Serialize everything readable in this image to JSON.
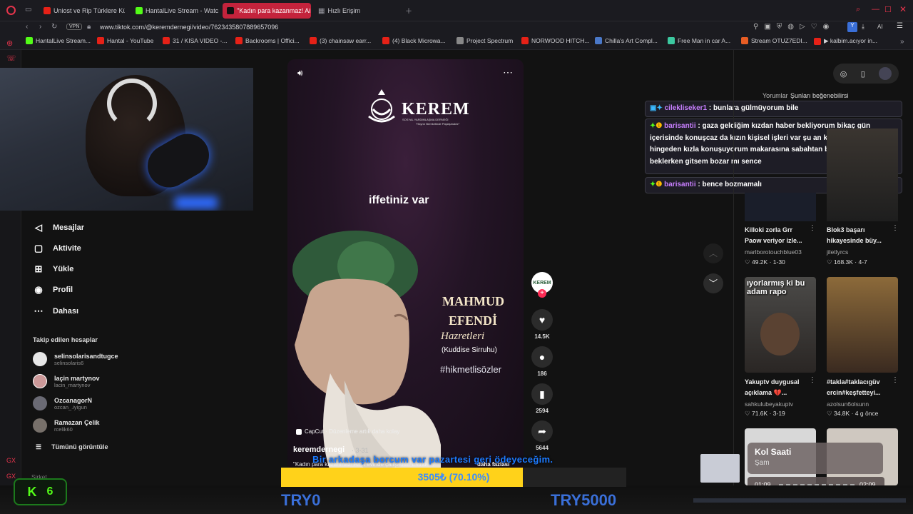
{
  "tabs": [
    {
      "label": "Uniost ve Rip Türklere Kü"
    },
    {
      "label": "HantalLive Stream - Watc"
    },
    {
      "label": "\"Kadın para kazanmaz! Ai"
    },
    {
      "label": "Hızlı Erişim"
    }
  ],
  "address": {
    "url": "www.tiktok.com/@keremdernegi/video/7623435807889657096",
    "vpn": "VPN"
  },
  "bookmarks": [
    "HantalLive Stream...",
    "Hantal - YouTube",
    "31 / KISA VIDEO -...",
    "Backrooms | Offici...",
    "(3) chainsaw earr...",
    "(4) Black Microwa...",
    "Project Spectrum",
    "NORWOOD HITCH...",
    "Chilla's Art Compl...",
    "Free Man in car A...",
    "Stream OTUZ7EDI...",
    "▶ kalbim.acıyor in..."
  ],
  "sidebar": {
    "nav": [
      "Mesajlar",
      "Aktivite",
      "Yükle",
      "Profil",
      "Dahası"
    ],
    "following_title": "Takip edilen hesaplar",
    "accounts": [
      {
        "name": "selinsolarisandtugce",
        "handle": "selinsolaris6"
      },
      {
        "name": "laçin martynov",
        "handle": "lacin_martynov"
      },
      {
        "name": "OzcanagorN",
        "handle": "ozcan_.iyigun"
      },
      {
        "name": "Ramazan Çelik",
        "handle": "rcelik60"
      }
    ],
    "see_all": "Tümünü görüntüle",
    "bottom_cut": "Şirket"
  },
  "video": {
    "logo_name": "KEREM",
    "logo_sub": "SOSYAL YARDIMLAŞMA DERNEĞİ",
    "logo_tag": "\"Hayrın Bereketinde Paylaşmaktır\"",
    "caption_top": "iffetiniz var",
    "name1": "MAHMUD",
    "name2": "EFENDİ",
    "script": "Hazretleri",
    "kuddise": "(Kuddise Sirruhu)",
    "hashtag": "#hikmetlisözler",
    "capcut": "CapCut · Düzenleme artık daha kolay",
    "author": "keremdernegi",
    "date": "3-31",
    "desc": "\"Kadın para kazanmaz! Ama evinde çalışabilir. Evinde...",
    "more": "daha fazlası"
  },
  "actions": [
    {
      "icon": "heart-icon",
      "count": "14.5K"
    },
    {
      "icon": "comment-icon",
      "count": "186"
    },
    {
      "icon": "bookmark-icon",
      "count": "2594"
    },
    {
      "icon": "share-icon",
      "count": "5644"
    }
  ],
  "overlay_subtitle": "Bir arkadaşa borcum var pazartesi geri ödeyeceğim.",
  "chat": [
    {
      "user": "cilekliseker1",
      "msg": "bunlara gülmüyorum bile"
    },
    {
      "user": "barisantii",
      "msg": "gaza geldiğim kızdan haber bekliyorum bikaç gün içerisinde konuşcaz da kızın kişisel işleri var şu an konuşmuyoruz hingeden kızla konuşuyorum makarasına sabahtan beri eve çağırdı beklerken gitsem bozar mı sence"
    },
    {
      "user": "barisantii",
      "msg": "bence bozmamalı"
    }
  ],
  "right_header": {
    "tab1": "Yorumlar",
    "tab2": "Şunları beğenebilirsi"
  },
  "cards": [
    {
      "title": "Killoki zorla Grr Paow veriyor izle...",
      "author": "marlborotouchblue03",
      "likes": "49.2K",
      "date": "1-30"
    },
    {
      "title": "Blok3 başarı hikayesinde büy...",
      "author": "jiletlyrcs",
      "likes": "168.3K",
      "date": "4-7"
    },
    {
      "title": "Yakuptv duygusal açıklama 💔...",
      "author": "sahkulubeyakuptv",
      "likes": "71.6K",
      "date": "3-19",
      "thumb_text": "ıyorlarmış ki bu adam rapo"
    },
    {
      "title": "#takla#taklacıgüv ercin#keşfetteyi...",
      "author": "azolsun6olsunn",
      "likes": "34.8K",
      "date": "4 g önce"
    }
  ],
  "donation": {
    "progress_text": "3505₺ (70.10%)",
    "progress": 0.701,
    "min": "TRY0",
    "max": "TRY5000"
  },
  "music": {
    "title": "Kol Saati",
    "artist": "Şam",
    "current": "01:09",
    "total": "02:09",
    "progress": 0.53
  },
  "kick": {
    "count": "6"
  }
}
